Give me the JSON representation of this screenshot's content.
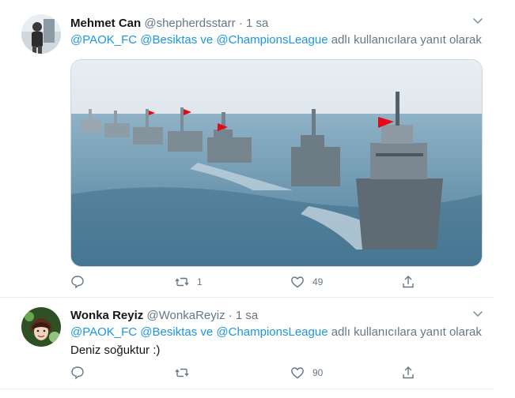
{
  "tweets": [
    {
      "name": "Mehmet Can",
      "handle": "@shepherdsstarr",
      "time": "· 1 sa",
      "reply_mentions": "@PAOK_FC @Besiktas ve @ChampionsLeague",
      "reply_suffix": "adlı kullanıcılara yanıt olarak",
      "image_alt": "naval ships with Turkish flags sailing in a line",
      "actions": {
        "reply_count": "",
        "retweet_count": "1",
        "like_count": "49"
      }
    },
    {
      "name": "Wonka Reyiz",
      "handle": "@WonkaReyiz",
      "time": "· 1 sa",
      "reply_mentions": "@PAOK_FC @Besiktas ve @ChampionsLeague",
      "reply_suffix": "adlı kullanıcılara yanıt olarak",
      "text": "Deniz soğuktur :)",
      "actions": {
        "reply_count": "",
        "retweet_count": "",
        "like_count": "90"
      }
    }
  ],
  "colors": {
    "link": "#1b95e0",
    "muted": "#657786",
    "text": "#14171a",
    "flag_red": "#e30a17"
  },
  "icons": [
    "reply-icon",
    "retweet-icon",
    "like-icon",
    "share-icon",
    "chevron-down-icon"
  ]
}
